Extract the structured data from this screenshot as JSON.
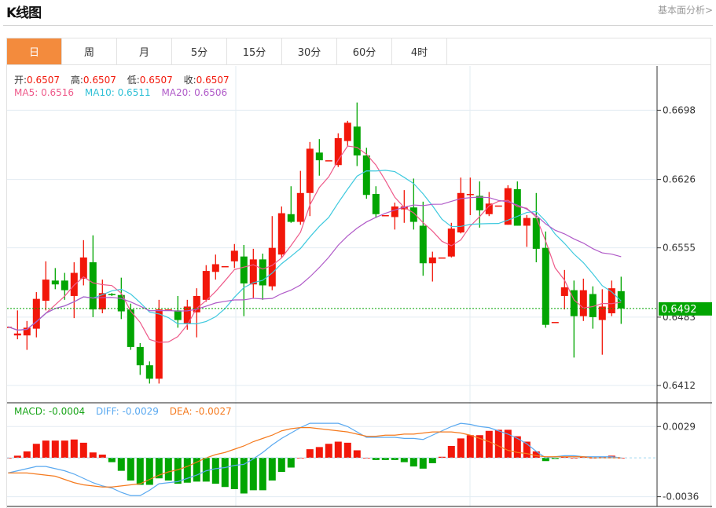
{
  "header": {
    "title": "K线图",
    "more_link": "基本面分析>"
  },
  "tabs": [
    {
      "label": "日",
      "active": true
    },
    {
      "label": "周"
    },
    {
      "label": "月"
    },
    {
      "label": "5分"
    },
    {
      "label": "15分"
    },
    {
      "label": "30分"
    },
    {
      "label": "60分"
    },
    {
      "label": "4时"
    }
  ],
  "ohlc_info": {
    "open_label": "开:",
    "open": "0.6507",
    "high_label": "高:",
    "high": "0.6507",
    "low_label": "低:",
    "low": "0.6507",
    "close_label": "收:",
    "close": "0.6507"
  },
  "ma_info": {
    "ma5_label": "MA5:",
    "ma5": "0.6516",
    "ma10_label": "MA10:",
    "ma10": "0.6511",
    "ma20_label": "MA20:",
    "ma20": "0.6506"
  },
  "macd_info": {
    "macd_label": "MACD:",
    "macd": "-0.0004",
    "diff_label": "DIFF:",
    "diff": "-0.0029",
    "dea_label": "DEA:",
    "dea": "-0.0027"
  },
  "colors": {
    "up": "#f2170a",
    "down": "#02a502",
    "ma5": "#ee5a8a",
    "ma10": "#3ec9de",
    "ma20": "#b05ac8",
    "diff": "#5aa9f0",
    "dea": "#f57a1e",
    "tab_active": "#f38b3d",
    "grid": "#e3ecf2"
  },
  "chart_data": [
    {
      "type": "candlestick",
      "price_ticks": [
        "0.6698",
        "0.6626",
        "0.6555",
        "0.6483",
        "0.6412"
      ],
      "ylim": [
        0.6394,
        0.6744
      ],
      "current_price": "0.6492",
      "grid": true,
      "candles": [
        [
          0.6473,
          0.6473,
          0.6473,
          0.6473
        ],
        [
          0.6464,
          0.649,
          0.646,
          0.6466
        ],
        [
          0.6464,
          0.6479,
          0.6449,
          0.6472
        ],
        [
          0.6471,
          0.6509,
          0.6462,
          0.6502
        ],
        [
          0.65,
          0.6541,
          0.649,
          0.6522
        ],
        [
          0.6521,
          0.6534,
          0.6512,
          0.6517
        ],
        [
          0.6521,
          0.6529,
          0.6501,
          0.6511
        ],
        [
          0.6505,
          0.654,
          0.6482,
          0.6529
        ],
        [
          0.6523,
          0.6563,
          0.6516,
          0.6545
        ],
        [
          0.654,
          0.6568,
          0.6483,
          0.6491
        ],
        [
          0.6491,
          0.6522,
          0.6487,
          0.6508
        ],
        [
          0.6507,
          0.6508,
          0.6505,
          0.6506
        ],
        [
          0.6506,
          0.6524,
          0.6481,
          0.6489
        ],
        [
          0.6491,
          0.6497,
          0.6449,
          0.6452
        ],
        [
          0.6452,
          0.6456,
          0.6423,
          0.6433
        ],
        [
          0.6433,
          0.6437,
          0.6414,
          0.6419
        ],
        [
          0.6419,
          0.6501,
          0.6414,
          0.6491
        ],
        [
          0.6491,
          0.6491,
          0.6491,
          0.6491
        ],
        [
          0.649,
          0.6505,
          0.6472,
          0.648
        ],
        [
          0.6476,
          0.6501,
          0.647,
          0.6494
        ],
        [
          0.6488,
          0.6513,
          0.6462,
          0.6505
        ],
        [
          0.6501,
          0.6537,
          0.6499,
          0.6531
        ],
        [
          0.653,
          0.6548,
          0.6522,
          0.6538
        ],
        [
          0.6536,
          0.6536,
          0.6536,
          0.6536
        ],
        [
          0.6541,
          0.6559,
          0.6534,
          0.6552
        ],
        [
          0.6546,
          0.6558,
          0.6484,
          0.6518
        ],
        [
          0.6517,
          0.6554,
          0.6503,
          0.6543
        ],
        [
          0.6543,
          0.6549,
          0.6501,
          0.6516
        ],
        [
          0.6515,
          0.6588,
          0.6511,
          0.6555
        ],
        [
          0.6548,
          0.6598,
          0.6545,
          0.6591
        ],
        [
          0.659,
          0.6619,
          0.6581,
          0.6582
        ],
        [
          0.6582,
          0.6635,
          0.6579,
          0.6612
        ],
        [
          0.6612,
          0.6665,
          0.6588,
          0.6658
        ],
        [
          0.6654,
          0.6668,
          0.663,
          0.6646
        ],
        [
          0.6646,
          0.6646,
          0.6646,
          0.6646
        ],
        [
          0.6641,
          0.6674,
          0.6639,
          0.6669
        ],
        [
          0.6666,
          0.6687,
          0.6661,
          0.6685
        ],
        [
          0.6681,
          0.6706,
          0.664,
          0.6651
        ],
        [
          0.6651,
          0.6659,
          0.6606,
          0.661
        ],
        [
          0.6611,
          0.6619,
          0.6586,
          0.659
        ],
        [
          0.6589,
          0.6589,
          0.6589,
          0.6589
        ],
        [
          0.6587,
          0.6602,
          0.6574,
          0.6598
        ],
        [
          0.6595,
          0.6615,
          0.6581,
          0.6598
        ],
        [
          0.6597,
          0.6627,
          0.6574,
          0.6582
        ],
        [
          0.6578,
          0.6603,
          0.6526,
          0.6539
        ],
        [
          0.6539,
          0.6551,
          0.652,
          0.6545
        ],
        [
          0.6545,
          0.6545,
          0.6545,
          0.6545
        ],
        [
          0.6546,
          0.6581,
          0.6545,
          0.6575
        ],
        [
          0.6571,
          0.6628,
          0.657,
          0.6612
        ],
        [
          0.6611,
          0.6628,
          0.6589,
          0.6611
        ],
        [
          0.6609,
          0.6624,
          0.6576,
          0.6594
        ],
        [
          0.659,
          0.6613,
          0.6588,
          0.6601
        ],
        [
          0.6599,
          0.6599,
          0.6599,
          0.6599
        ],
        [
          0.6579,
          0.662,
          0.6579,
          0.6617
        ],
        [
          0.6616,
          0.6624,
          0.6578,
          0.6578
        ],
        [
          0.6578,
          0.6589,
          0.6556,
          0.6586
        ],
        [
          0.6586,
          0.6612,
          0.654,
          0.6554
        ],
        [
          0.6555,
          0.6572,
          0.6472,
          0.6475
        ],
        [
          0.6478,
          0.6478,
          0.6478,
          0.6478
        ],
        [
          0.6505,
          0.6532,
          0.6491,
          0.6514
        ],
        [
          0.6511,
          0.6521,
          0.6441,
          0.6484
        ],
        [
          0.6484,
          0.6523,
          0.6479,
          0.6511
        ],
        [
          0.6507,
          0.6515,
          0.6471,
          0.6483
        ],
        [
          0.648,
          0.6512,
          0.6444,
          0.6494
        ],
        [
          0.6487,
          0.6521,
          0.6484,
          0.6513
        ],
        [
          0.651,
          0.6525,
          0.6476,
          0.6492
        ]
      ]
    },
    {
      "type": "macd",
      "ticks": [
        "0.0029",
        "-0.0036"
      ],
      "ylim": [
        -0.0045,
        0.0051
      ],
      "histogram": [
        0,
        0.0002,
        0.0006,
        0.0013,
        0.0016,
        0.0016,
        0.0016,
        0.0017,
        0.0014,
        0.0005,
        0.0003,
        -0.0004,
        -0.0012,
        -0.0021,
        -0.0025,
        -0.0025,
        -0.0019,
        -0.0021,
        -0.0024,
        -0.0023,
        -0.0022,
        -0.0022,
        -0.0024,
        -0.0027,
        -0.0029,
        -0.0033,
        -0.003,
        -0.003,
        -0.0021,
        -0.0013,
        -0.0009,
        0,
        0.0008,
        0.001,
        0.0013,
        0.0015,
        0.0014,
        0.0007,
        0,
        -0.0002,
        -0.0002,
        -0.0002,
        -0.0004,
        -0.0008,
        -0.001,
        -0.0005,
        0.0001,
        0.0011,
        0.0018,
        0.0021,
        0.0021,
        0.0025,
        0.0026,
        0.0026,
        0.002,
        0.0015,
        0.0006,
        -0.0003,
        -0.0001,
        0.0001,
        0,
        0.0001,
        0,
        0.0001,
        0.0002,
        0
      ],
      "diff": [
        -0.0014,
        -0.0012,
        -0.001,
        -0.0008,
        -0.0008,
        -0.001,
        -0.0012,
        -0.0015,
        -0.0019,
        -0.0023,
        -0.0026,
        -0.0028,
        -0.0032,
        -0.0035,
        -0.0035,
        -0.003,
        -0.0024,
        -0.0023,
        -0.0022,
        -0.0019,
        -0.0016,
        -0.0012,
        -0.001,
        -0.0009,
        -0.0007,
        -0.0006,
        -0.0001,
        0.0005,
        0.0012,
        0.0018,
        0.0023,
        0.0028,
        0.0032,
        0.0032,
        0.0032,
        0.0032,
        0.0029,
        0.0024,
        0.0019,
        0.0019,
        0.0019,
        0.0019,
        0.0018,
        0.0018,
        0.0017,
        0.0021,
        0.0025,
        0.0029,
        0.0032,
        0.0031,
        0.0029,
        0.0028,
        0.0025,
        0.0022,
        0.0018,
        0.0013,
        0.0006,
        0,
        0.0001,
        0.0002,
        0.0002,
        0.0001,
        0.0001,
        0.0001,
        0.0001,
        0
      ],
      "dea": [
        -0.0014,
        -0.0014,
        -0.0014,
        -0.0015,
        -0.0016,
        -0.0017,
        -0.002,
        -0.0023,
        -0.0025,
        -0.0026,
        -0.0027,
        -0.0027,
        -0.0026,
        -0.0025,
        -0.0024,
        -0.002,
        -0.0016,
        -0.0013,
        -0.0011,
        -0.0008,
        -0.0004,
        0,
        0.0003,
        0.0005,
        0.0008,
        0.0011,
        0.0015,
        0.0018,
        0.0021,
        0.0025,
        0.0027,
        0.0028,
        0.0028,
        0.0027,
        0.0026,
        0.0025,
        0.0024,
        0.0022,
        0.002,
        0.002,
        0.0021,
        0.0021,
        0.0022,
        0.0022,
        0.0023,
        0.0024,
        0.0024,
        0.0024,
        0.0023,
        0.0021,
        0.0018,
        0.0015,
        0.0011,
        0.0007,
        0.0005,
        0.0004,
        0.0002,
        0.0001,
        0.0001,
        0.0001,
        0.0001,
        0.0001,
        0,
        0,
        0,
        0
      ]
    }
  ]
}
